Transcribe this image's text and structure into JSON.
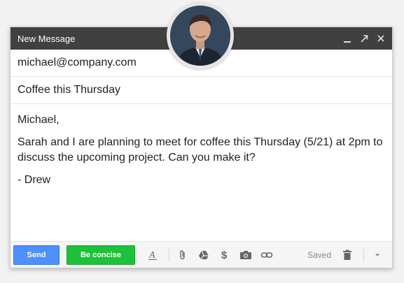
{
  "window": {
    "title": "New Message",
    "controls": [
      "minimize-icon",
      "expand-icon",
      "close-icon"
    ]
  },
  "to": "michael@company.com",
  "subject": "Coffee this Thursday",
  "body": {
    "greeting": "Michael,",
    "paragraph": "Sarah and I are planning to meet for coffee this Thursday (5/21) at 2pm to discuss the upcoming project. Can you make it?",
    "signature": "- Drew"
  },
  "toolbar": {
    "send_label": "Send",
    "concise_label": "Be concise",
    "saved_label": "Saved",
    "icons": [
      "format-text-icon",
      "attach-icon",
      "drive-icon",
      "money-icon",
      "camera-icon",
      "link-icon",
      "trash-icon",
      "more-options-icon"
    ]
  },
  "colors": {
    "titlebar": "#404040",
    "send": "#4d90fe",
    "concise": "#1ec13a"
  }
}
